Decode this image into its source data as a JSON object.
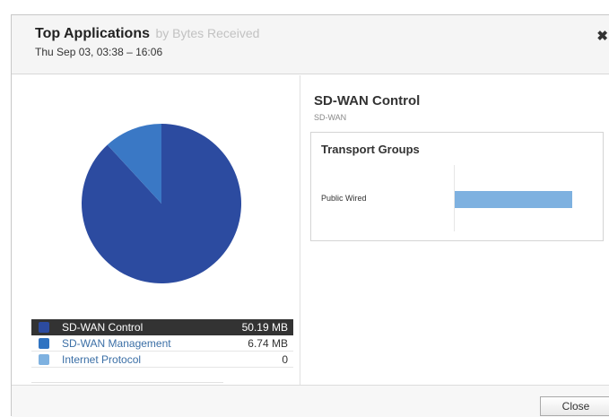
{
  "dialog": {
    "title": "Top Applications",
    "title_sub": "by Bytes Received",
    "subtitle": "Thu Sep 03, 03:38 – 16:06",
    "close_x": "✖",
    "close_button": "Close"
  },
  "legend": [
    {
      "label": "SD-WAN Control",
      "value": "50.19 MB",
      "color": "#2c4ba0",
      "selected": true
    },
    {
      "label": "SD-WAN Management",
      "value": "6.74 MB",
      "color": "#2f73c2",
      "selected": false
    },
    {
      "label": "Internet Protocol",
      "value": "0",
      "color": "#7eb1e0",
      "selected": false
    }
  ],
  "chart_data": [
    {
      "type": "pie",
      "labels": [
        "SD-WAN Control",
        "SD-WAN Management",
        "Internet Protocol"
      ],
      "values": [
        50.19,
        6.74,
        0
      ],
      "colors": [
        "#2c4ba0",
        "#3a78c5",
        "#7eb1e0"
      ]
    },
    {
      "type": "bar",
      "categories": [
        "Public Wired"
      ],
      "values": [
        1
      ]
    }
  ],
  "detail": {
    "app_name": "SD-WAN Control",
    "app_category": "SD-WAN",
    "transport_title": "Transport Groups",
    "transport_rows": [
      {
        "label": "Public Wired"
      }
    ]
  }
}
